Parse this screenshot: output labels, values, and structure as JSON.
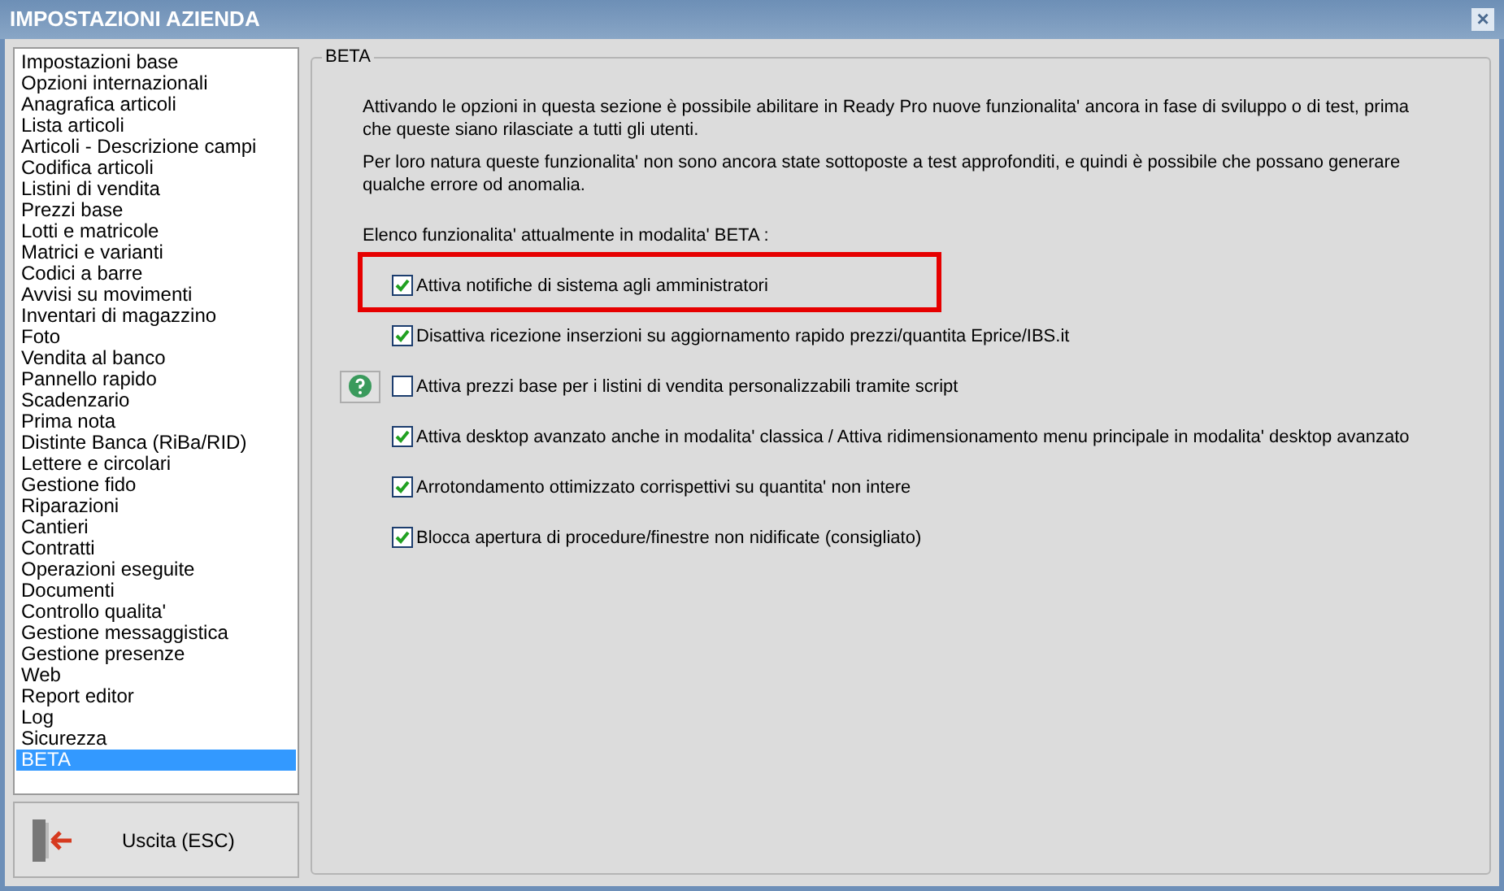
{
  "window": {
    "title": "IMPOSTAZIONI AZIENDA",
    "close": "×"
  },
  "sidebar": {
    "items": [
      {
        "label": "Impostazioni base",
        "selected": false
      },
      {
        "label": "Opzioni internazionali",
        "selected": false
      },
      {
        "label": "Anagrafica articoli",
        "selected": false
      },
      {
        "label": "Lista articoli",
        "selected": false
      },
      {
        "label": "Articoli - Descrizione campi",
        "selected": false
      },
      {
        "label": "Codifica articoli",
        "selected": false
      },
      {
        "label": "Listini di vendita",
        "selected": false
      },
      {
        "label": "Prezzi base",
        "selected": false
      },
      {
        "label": "Lotti e matricole",
        "selected": false
      },
      {
        "label": "Matrici e varianti",
        "selected": false
      },
      {
        "label": "Codici a barre",
        "selected": false
      },
      {
        "label": "Avvisi su movimenti",
        "selected": false
      },
      {
        "label": "Inventari di magazzino",
        "selected": false
      },
      {
        "label": "Foto",
        "selected": false
      },
      {
        "label": "Vendita al banco",
        "selected": false
      },
      {
        "label": "Pannello rapido",
        "selected": false
      },
      {
        "label": "Scadenzario",
        "selected": false
      },
      {
        "label": "Prima nota",
        "selected": false
      },
      {
        "label": "Distinte Banca (RiBa/RID)",
        "selected": false
      },
      {
        "label": "Lettere e circolari",
        "selected": false
      },
      {
        "label": "Gestione fido",
        "selected": false
      },
      {
        "label": "Riparazioni",
        "selected": false
      },
      {
        "label": "Cantieri",
        "selected": false
      },
      {
        "label": "Contratti",
        "selected": false
      },
      {
        "label": "Operazioni eseguite",
        "selected": false
      },
      {
        "label": "Documenti",
        "selected": false
      },
      {
        "label": "Controllo qualita'",
        "selected": false
      },
      {
        "label": "Gestione messaggistica",
        "selected": false
      },
      {
        "label": "Gestione presenze",
        "selected": false
      },
      {
        "label": "Web",
        "selected": false
      },
      {
        "label": "Report editor",
        "selected": false
      },
      {
        "label": "Log",
        "selected": false
      },
      {
        "label": "Sicurezza",
        "selected": false
      },
      {
        "label": "BETA",
        "selected": true
      }
    ],
    "exit_button": "Uscita (ESC)"
  },
  "panel": {
    "title": "BETA",
    "paragraphs": [
      "Attivando le opzioni in questa sezione è possibile abilitare in Ready Pro nuove funzionalita' ancora in fase di sviluppo o di test, prima che queste siano rilasciate a tutti gli utenti.",
      "Per loro natura queste funzionalita' non sono ancora state sottoposte a test approfonditi, e quindi è possibile che possano generare qualche errore od anomalia."
    ],
    "list_heading": "Elenco funzionalita' attualmente in modalita' BETA :",
    "options": [
      {
        "label": "Attiva notifiche di sistema agli amministratori",
        "checked": true,
        "highlighted": true,
        "help": false
      },
      {
        "label": "Disattiva ricezione inserzioni su aggiornamento rapido prezzi/quantita Eprice/IBS.it",
        "checked": true,
        "highlighted": false,
        "help": false
      },
      {
        "label": "Attiva prezzi base per i listini di vendita personalizzabili tramite script",
        "checked": false,
        "highlighted": false,
        "help": true
      },
      {
        "label": "Attiva desktop avanzato anche in modalita' classica / Attiva ridimensionamento menu principale in modalita' desktop avanzato",
        "checked": true,
        "highlighted": false,
        "help": false
      },
      {
        "label": "Arrotondamento ottimizzato corrispettivi su quantita' non intere",
        "checked": true,
        "highlighted": false,
        "help": false
      },
      {
        "label": "Blocca apertura di procedure/finestre non nidificate (consigliato)",
        "checked": true,
        "highlighted": false,
        "help": false
      }
    ]
  }
}
